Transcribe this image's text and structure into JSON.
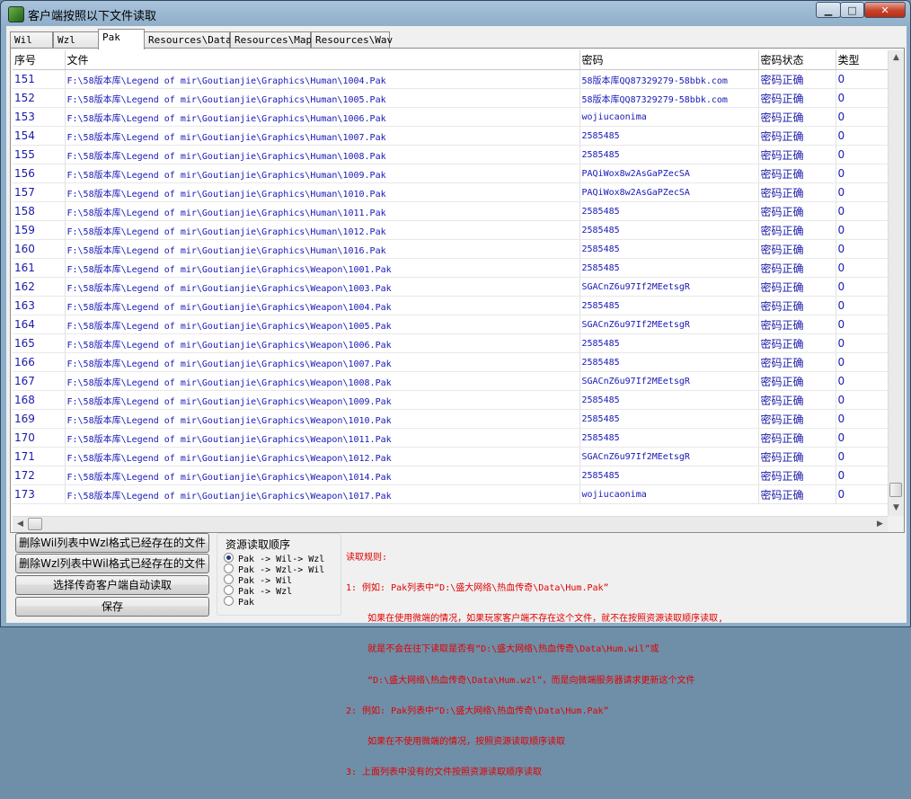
{
  "window": {
    "title": "客户端按照以下文件读取",
    "controls": {
      "minimize": "▁",
      "maximize": "□",
      "close": "✕"
    }
  },
  "tabs": [
    {
      "label": "Wil"
    },
    {
      "label": "Wzl"
    },
    {
      "label": "Pak",
      "active": true
    },
    {
      "label": "Resources\\Data"
    },
    {
      "label": "Resources\\Map"
    },
    {
      "label": "Resources\\Wav"
    }
  ],
  "table": {
    "columns": [
      "序号",
      "文件",
      "密码",
      "密码状态",
      "类型"
    ],
    "rows": [
      [
        "151",
        "F:\\58版本库\\Legend of mir\\Goutianjie\\Graphics\\Human\\1004.Pak",
        "58版本库QQ87329279-58bbk.com",
        "密码正确",
        "0"
      ],
      [
        "152",
        "F:\\58版本库\\Legend of mir\\Goutianjie\\Graphics\\Human\\1005.Pak",
        "58版本库QQ87329279-58bbk.com",
        "密码正确",
        "0"
      ],
      [
        "153",
        "F:\\58版本库\\Legend of mir\\Goutianjie\\Graphics\\Human\\1006.Pak",
        "wojiucaonima",
        "密码正确",
        "0"
      ],
      [
        "154",
        "F:\\58版本库\\Legend of mir\\Goutianjie\\Graphics\\Human\\1007.Pak",
        "2585485",
        "密码正确",
        "0"
      ],
      [
        "155",
        "F:\\58版本库\\Legend of mir\\Goutianjie\\Graphics\\Human\\1008.Pak",
        "2585485",
        "密码正确",
        "0"
      ],
      [
        "156",
        "F:\\58版本库\\Legend of mir\\Goutianjie\\Graphics\\Human\\1009.Pak",
        "PAQiWox8w2AsGaPZecSA",
        "密码正确",
        "0"
      ],
      [
        "157",
        "F:\\58版本库\\Legend of mir\\Goutianjie\\Graphics\\Human\\1010.Pak",
        "PAQiWox8w2AsGaPZecSA",
        "密码正确",
        "0"
      ],
      [
        "158",
        "F:\\58版本库\\Legend of mir\\Goutianjie\\Graphics\\Human\\1011.Pak",
        "2585485",
        "密码正确",
        "0"
      ],
      [
        "159",
        "F:\\58版本库\\Legend of mir\\Goutianjie\\Graphics\\Human\\1012.Pak",
        "2585485",
        "密码正确",
        "0"
      ],
      [
        "160",
        "F:\\58版本库\\Legend of mir\\Goutianjie\\Graphics\\Human\\1016.Pak",
        "2585485",
        "密码正确",
        "0"
      ],
      [
        "161",
        "F:\\58版本库\\Legend of mir\\Goutianjie\\Graphics\\Weapon\\1001.Pak",
        "2585485",
        "密码正确",
        "0"
      ],
      [
        "162",
        "F:\\58版本库\\Legend of mir\\Goutianjie\\Graphics\\Weapon\\1003.Pak",
        "SGACnZ6u97If2MEetsgR",
        "密码正确",
        "0"
      ],
      [
        "163",
        "F:\\58版本库\\Legend of mir\\Goutianjie\\Graphics\\Weapon\\1004.Pak",
        "2585485",
        "密码正确",
        "0"
      ],
      [
        "164",
        "F:\\58版本库\\Legend of mir\\Goutianjie\\Graphics\\Weapon\\1005.Pak",
        "SGACnZ6u97If2MEetsgR",
        "密码正确",
        "0"
      ],
      [
        "165",
        "F:\\58版本库\\Legend of mir\\Goutianjie\\Graphics\\Weapon\\1006.Pak",
        "2585485",
        "密码正确",
        "0"
      ],
      [
        "166",
        "F:\\58版本库\\Legend of mir\\Goutianjie\\Graphics\\Weapon\\1007.Pak",
        "2585485",
        "密码正确",
        "0"
      ],
      [
        "167",
        "F:\\58版本库\\Legend of mir\\Goutianjie\\Graphics\\Weapon\\1008.Pak",
        "SGACnZ6u97If2MEetsgR",
        "密码正确",
        "0"
      ],
      [
        "168",
        "F:\\58版本库\\Legend of mir\\Goutianjie\\Graphics\\Weapon\\1009.Pak",
        "2585485",
        "密码正确",
        "0"
      ],
      [
        "169",
        "F:\\58版本库\\Legend of mir\\Goutianjie\\Graphics\\Weapon\\1010.Pak",
        "2585485",
        "密码正确",
        "0"
      ],
      [
        "170",
        "F:\\58版本库\\Legend of mir\\Goutianjie\\Graphics\\Weapon\\1011.Pak",
        "2585485",
        "密码正确",
        "0"
      ],
      [
        "171",
        "F:\\58版本库\\Legend of mir\\Goutianjie\\Graphics\\Weapon\\1012.Pak",
        "SGACnZ6u97If2MEetsgR",
        "密码正确",
        "0"
      ],
      [
        "172",
        "F:\\58版本库\\Legend of mir\\Goutianjie\\Graphics\\Weapon\\1014.Pak",
        "2585485",
        "密码正确",
        "0"
      ],
      [
        "173",
        "F:\\58版本库\\Legend of mir\\Goutianjie\\Graphics\\Weapon\\1017.Pak",
        "wojiucaonima",
        "密码正确",
        "0"
      ]
    ]
  },
  "buttons": {
    "delete_wil": "删除Wil列表中Wzl格式已经存在的文件",
    "delete_wzl": "删除Wzl列表中Wil格式已经存在的文件",
    "select_client": "选择传奇客户端自动读取",
    "save": "保存"
  },
  "order_group": {
    "title": "资源读取顺序",
    "options": [
      {
        "label": "Pak -> Wil-> Wzl",
        "selected": true
      },
      {
        "label": "Pak -> Wzl-> Wil",
        "selected": false
      },
      {
        "label": "Pak -> Wil",
        "selected": false
      },
      {
        "label": "Pak -> Wzl",
        "selected": false
      },
      {
        "label": "Pak",
        "selected": false
      }
    ]
  },
  "rules": [
    "读取规则:",
    "1: 例如: Pak列表中“D:\\盛大网络\\热血传奇\\Data\\Hum.Pak”",
    "    如果在使用微端的情况，如果玩家客户端不存在这个文件，就不在按照资源读取顺序读取,",
    "    就是不会在往下读取是否有“D:\\盛大网络\\热血传奇\\Data\\Hum.wil”或",
    "    “D:\\盛大网络\\热血传奇\\Data\\Hum.wzl”，而是向微端服务器请求更新这个文件",
    "2: 例如: Pak列表中“D:\\盛大网络\\热血传奇\\Data\\Hum.Pak”",
    "    如果在不使用微端的情况，按照资源读取顺序读取",
    "3: 上面列表中没有的文件按照资源读取顺序读取"
  ]
}
